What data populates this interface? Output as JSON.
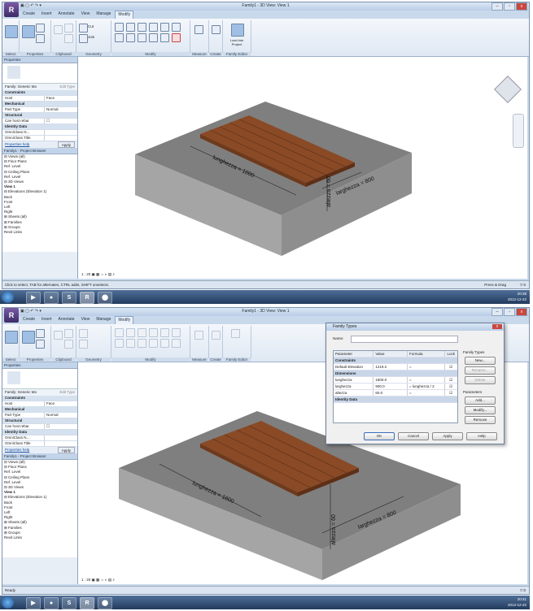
{
  "app": {
    "title": "Family1 - 3D View: View 1",
    "app_button": "R",
    "qat": "▣ ▢ ↶ ↷ ▾",
    "tabs": [
      "Create",
      "Insert",
      "Annotate",
      "View",
      "Manage",
      "Modify"
    ],
    "active_tab": "Modify",
    "ribbon_groups": [
      "Select",
      "Properties",
      "Clipboard",
      "Geometry",
      "Modify",
      "Measure",
      "Create",
      "Family Editor"
    ],
    "ribbon_small": {
      "cut": "Cut",
      "join": "Join",
      "modify": "Modify",
      "load": "Load into Project"
    }
  },
  "properties": {
    "header": "Properties",
    "type_selector": "Family: Generic Mo",
    "edit_type": "Edit Type",
    "rows": [
      {
        "label": "Constraints",
        "value": "",
        "cat": true
      },
      {
        "label": "Host",
        "value": "Face",
        "cat": false
      },
      {
        "label": "Mechanical",
        "value": "",
        "cat": true
      },
      {
        "label": "Part Type",
        "value": "Normal",
        "cat": false
      },
      {
        "label": "Structural",
        "value": "",
        "cat": true
      },
      {
        "label": "Can host rebar",
        "value": "",
        "cat": false
      },
      {
        "label": "Identity Data",
        "value": "",
        "cat": true
      },
      {
        "label": "OmniClass N...",
        "value": "",
        "cat": false
      },
      {
        "label": "OmniClass Title",
        "value": "",
        "cat": false
      }
    ],
    "help": "Properties help",
    "apply": "Apply"
  },
  "browser": {
    "header": "Family1 - Project Browser",
    "items": [
      "⊟ Views (all)",
      "  ⊟ Floor Plans",
      "      Ref. Level",
      "  ⊟ Ceiling Plans",
      "      Ref. Level",
      "  ⊟ 3D Views",
      "      View 1",
      "  ⊟ Elevations (Elevation 1)",
      "      Back",
      "      Front",
      "      Left",
      "      Right",
      "⊞ Sheets (all)",
      "⊞ Families",
      "⊞ Groups",
      "  Revit Links"
    ]
  },
  "viewport": {
    "dim_length": "lunghezza = 1800",
    "dim_width": "larghezza = 800",
    "dim_height": "altezza = 60",
    "view_scale": "1 : 20",
    "viewcube": "⬢"
  },
  "status": {
    "top": "Click to select, TAB for alternates, CTRL adds, SHIFT unselects.",
    "bottom": "Ready",
    "press_drag": "Press & Drag",
    "filter": "▽:0"
  },
  "taskbar": {
    "time1": "20:38",
    "date1": "2012-12-22",
    "time2": "20:41",
    "date2": "2012-12-22",
    "icons": [
      "▶",
      "●",
      "S",
      "R",
      "⬤"
    ]
  },
  "dialog": {
    "title": "Family Types",
    "close": "x",
    "name_label": "Name:",
    "columns": [
      "Parameter",
      "Value",
      "Formula",
      "Lock"
    ],
    "rows": [
      {
        "c1": "Constraints",
        "c2": "",
        "c3": "",
        "c4": "",
        "cat": true
      },
      {
        "c1": "Default Elevation",
        "c2": "1219.2",
        "c3": "=",
        "c4": "☑",
        "cat": false
      },
      {
        "c1": "Dimensions",
        "c2": "",
        "c3": "",
        "c4": "",
        "cat": true
      },
      {
        "c1": "lunghezza",
        "c2": "1800.0",
        "c3": "=",
        "c4": "☑",
        "cat": false
      },
      {
        "c1": "larghezza",
        "c2": "900.0",
        "c3": "= lunghezza / 2",
        "c4": "☑",
        "cat": false
      },
      {
        "c1": "altezza",
        "c2": "60.0",
        "c3": "=",
        "c4": "☑",
        "cat": false
      },
      {
        "c1": "Identity Data",
        "c2": "",
        "c3": "",
        "c4": "",
        "cat": true
      }
    ],
    "family_types": "Family Types",
    "new": "New...",
    "rename": "Rename...",
    "delete": "Delete",
    "parameters": "Parameters",
    "add": "Add...",
    "modify": "Modify...",
    "remove": "Remove",
    "ok": "OK",
    "cancel": "Cancel",
    "apply": "Apply",
    "help": "Help"
  },
  "colors": {
    "wood": "#8a4a26",
    "slab_top": "#7f7f7f",
    "slab_side": "#9a9a9a",
    "slab_front": "#b4b4b4"
  }
}
